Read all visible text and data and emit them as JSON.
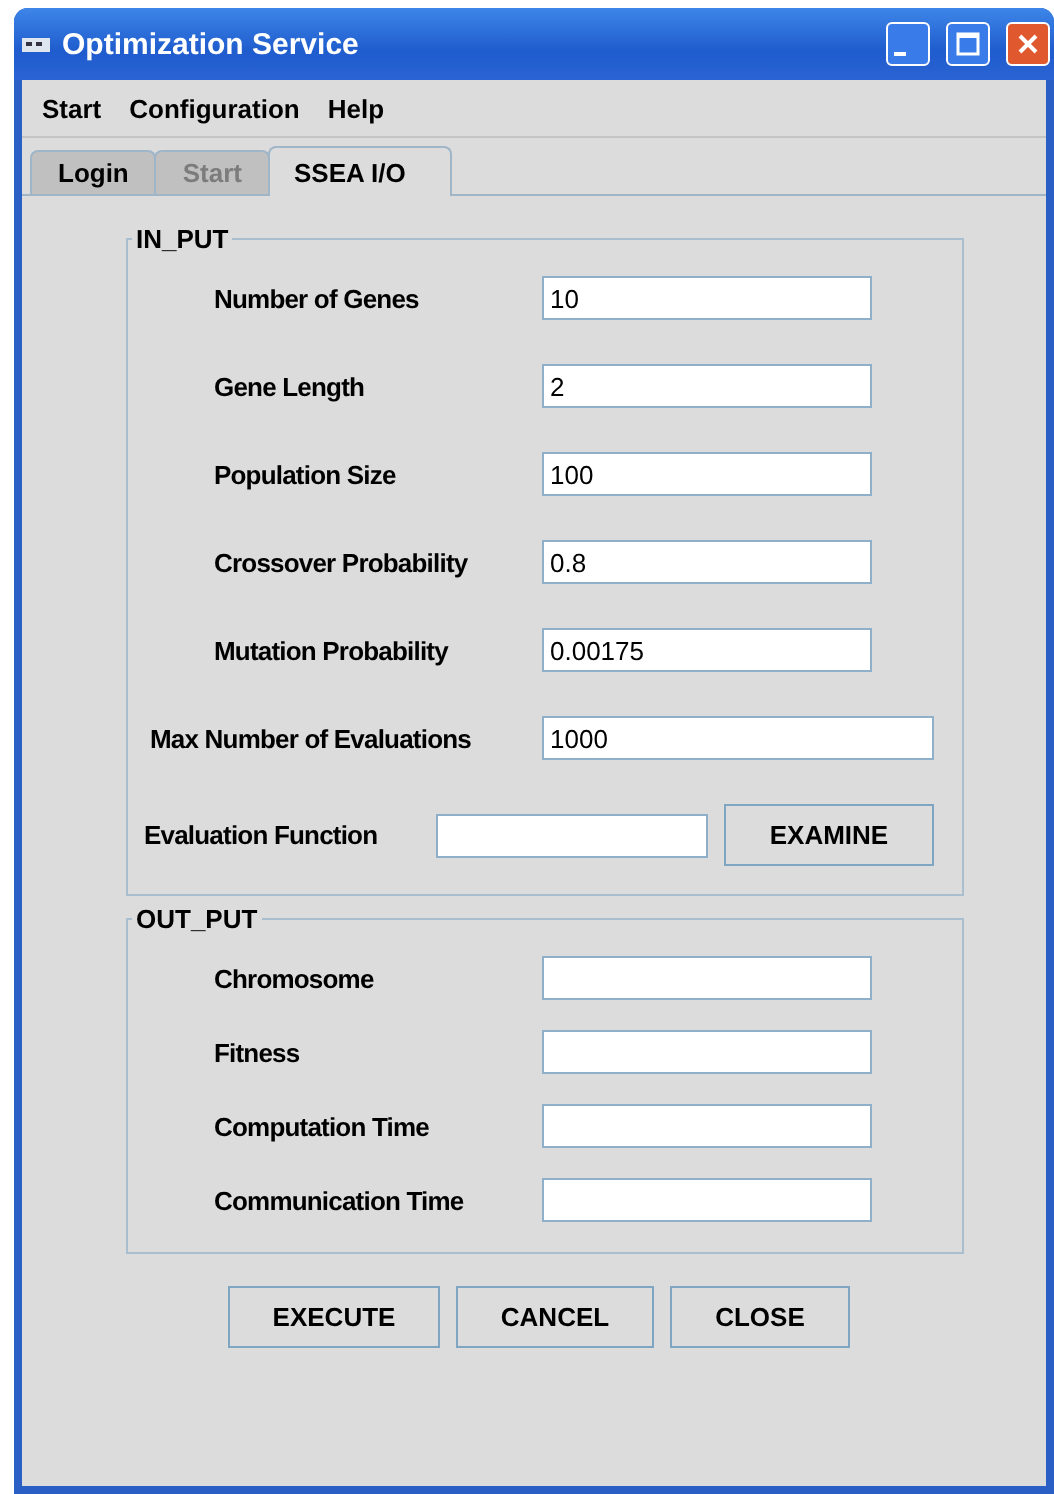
{
  "window": {
    "title": "Optimization Service"
  },
  "menu": [
    "Start",
    "Configuration",
    "Help"
  ],
  "tabs": [
    {
      "label": "Login",
      "selected": false,
      "disabled": false
    },
    {
      "label": "Start",
      "selected": false,
      "disabled": true
    },
    {
      "label": "SSEA I/O",
      "selected": true,
      "disabled": false
    }
  ],
  "input_group": {
    "title": "IN_PUT",
    "fields": [
      {
        "kind": "standard",
        "label": "Number of Genes",
        "value": "10"
      },
      {
        "kind": "standard",
        "label": "Gene Length",
        "value": "2"
      },
      {
        "kind": "standard",
        "label": "Population Size",
        "value": "100"
      },
      {
        "kind": "standard",
        "label": "Crossover Probability",
        "value": "0.8"
      },
      {
        "kind": "standard",
        "label": "Mutation Probability",
        "value": "0.00175"
      },
      {
        "kind": "wide",
        "label": "Max Number of Evaluations",
        "value": "1000"
      },
      {
        "kind": "browse",
        "label": "Evaluation Function",
        "button": "EXAMINE"
      }
    ]
  },
  "output_group": {
    "title": "OUT_PUT",
    "fields": [
      {
        "label": "Chromosome"
      },
      {
        "label": "Fitness"
      },
      {
        "label": "Computation Time"
      },
      {
        "label": "Communication Time"
      }
    ]
  },
  "buttons": [
    "EXECUTE",
    "CANCEL",
    "CLOSE"
  ]
}
